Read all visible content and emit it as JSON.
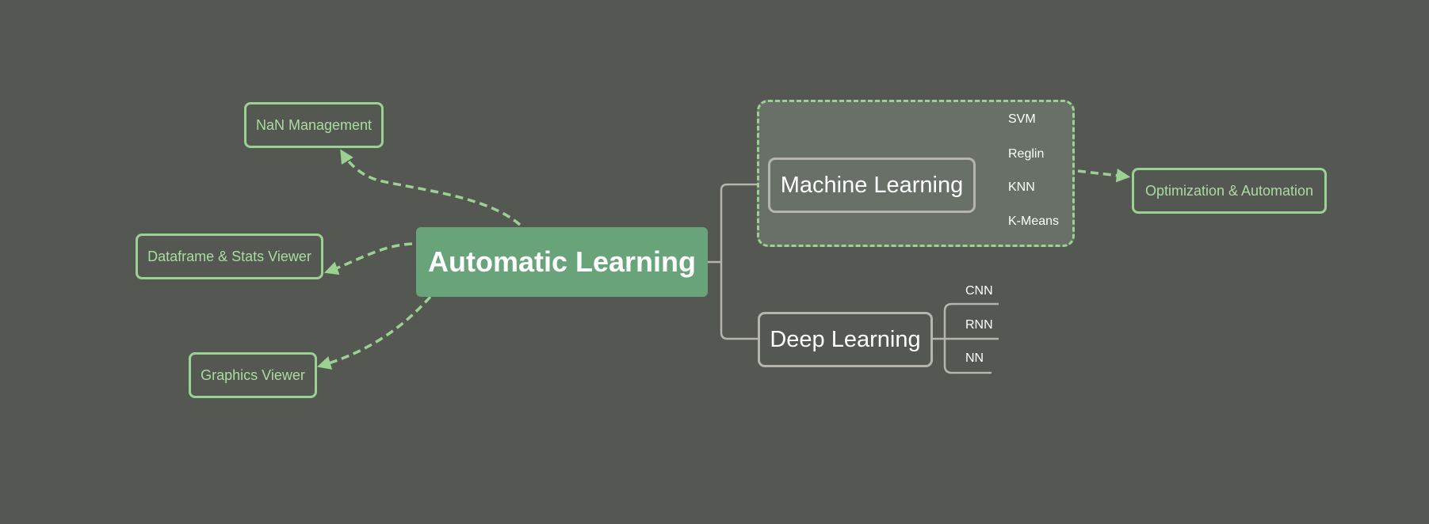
{
  "center": {
    "label": "Automatic Learning"
  },
  "branches": [
    {
      "label": "Machine Learning",
      "children": [
        "SVM",
        "Reglin",
        "KNN",
        "K-Means"
      ]
    },
    {
      "label": "Deep Learning",
      "children": [
        "CNN",
        "RNN",
        "NN"
      ]
    }
  ],
  "tools": [
    {
      "label": "NaN Management"
    },
    {
      "label": "Dataframe & Stats Viewer"
    },
    {
      "label": "Graphics Viewer"
    }
  ],
  "output": {
    "label": "Optimization & Automation"
  },
  "colors": {
    "background": "#555753",
    "center_fill": "#68a37a",
    "accent_green": "#9bd192",
    "connector_gray": "#b5b5ae",
    "group_fill": "#687068"
  }
}
